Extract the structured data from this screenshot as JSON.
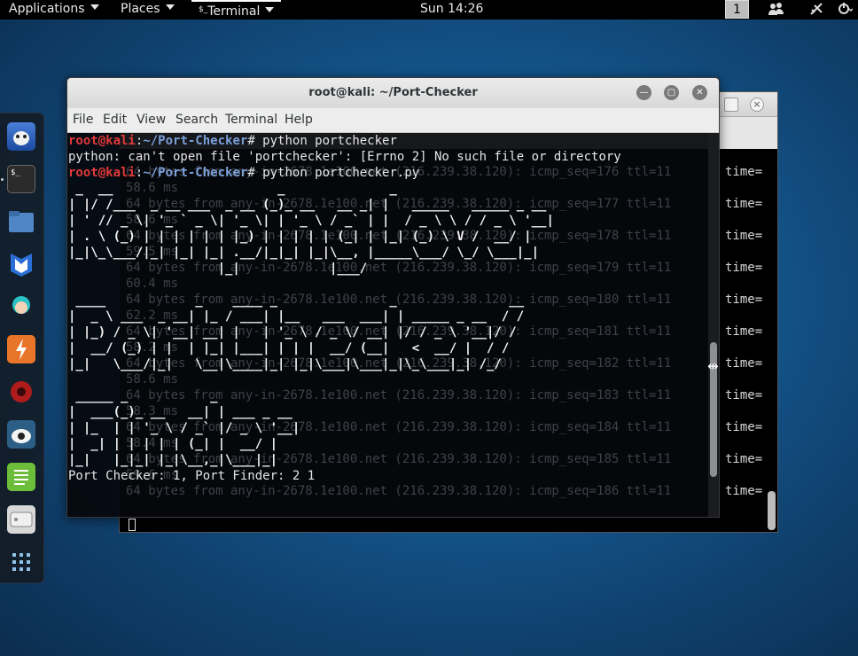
{
  "topbar": {
    "applications": "Applications",
    "places": "Places",
    "terminal": "Terminal",
    "clock": "Sun 14:26",
    "workspace": "1"
  },
  "dock": {
    "items": [
      "bug-app-icon",
      "terminal-app-icon",
      "files-app-icon",
      "metasploit-app-icon",
      "armitage-app-icon",
      "burp-app-icon",
      "faraday-app-icon",
      "maltego-app-icon",
      "notes-app-icon",
      "disk-app-icon",
      "show-apps-icon"
    ]
  },
  "front_terminal": {
    "title": "root@kali: ~/Port-Checker",
    "menu": [
      "File",
      "Edit",
      "View",
      "Search",
      "Terminal",
      "Help"
    ],
    "lines": [
      {
        "user": "root@kali",
        "sep": ":",
        "path": "~/Port-Checker",
        "cmd": "# python portchecker"
      },
      {
        "text": "python: can't open file 'portchecker': [Errno 2] No such file or directory"
      },
      {
        "user": "root@kali",
        "sep": ":",
        "path": "~/Port-Checker",
        "cmd": "# python portchecker.py"
      }
    ],
    "banner": [
      " _  __                      _              _                     ",
      "| |/ /___  _ __ ___  _ __ (_)_ __   __ _| |   _____   _____ _ __",
      "| ' // _ \\| '_ ` _ \\| '_ \\| | '_ \\ / _` | |  / _ \\ \\ / / _ \\ '__|",
      "| . \\ (_) | | | | | | |_) | | | | | (_| | |_| (_) \\ V /  __/ |",
      "|_|\\_\\___/|_| |_| |_| .__/|_|_| |_|\\__, |_____\\___/ \\_/ \\___|_|",
      "                    |_|            |___/",
      "",
      " ____            _    ____ _               _               __",
      "|  _ \\ ___  _ __| |_ / ___| |__   ___  ___| | _____ _ __  / /",
      "| |_) / _ \\| '__| __| |   | '_ \\ / _ \\/ __| |/ / _ \\ '__|/ /",
      "|  __/ (_) | |  | |_| |___| | | |  __/ (__|   <  __/ |  / /",
      "|_|   \\___/|_|   \\__|\\____|_| |_|\\___|\\___|_|\\_\\___|_| /_/",
      "",
      " _____ _           _",
      "|  ___(_)_ __   __| | ___ _ __",
      "| |_  | | '_ \\ / _` |/ _ \\ '__|",
      "|  _| | | | | | (_| |  __/ |",
      "|_|   |_|_| |_|\\__,_|\\___|_|"
    ],
    "footer": "Port Checker: 1, Port Finder: 2 1"
  },
  "back_terminal": {
    "time_label": "time=",
    "ghost_lines": [
      "58.6 ms",
      "64 bytes from any-in-2678.1e100.net (216.239.38.120): icmp_seq=177 ttl=11",
      "58.6 ms",
      "64 bytes from any-in-2678.1e100.net (216.239.38.120): icmp_seq=178 ttl=11",
      "59.5 ms",
      "64 bytes from any-in-2678.1e100.net (216.239.38.120): icmp_seq=179 ttl=11",
      "60.4 ms",
      "64 bytes from any-in-2678.1e100.net (216.239.38.120): icmp_seq=180 ttl=11",
      "62.2 ms",
      "64 bytes from any-in-2678.1e100.net (216.239.38.120): icmp_seq=181 ttl=11",
      "58.2 ms",
      "64 bytes from any-in-2678.1e100.net (216.239.38.120): icmp_seq=182 ttl=11",
      "58.6 ms",
      "64 bytes from any-in-2678.1e100.net (216.239.38.120): icmp_seq=183 ttl=11",
      "58.3 ms",
      "64 bytes from any-in-2678.1e100.net (216.239.38.120): icmp_seq=184 ttl=11",
      "58.4 ms",
      "64 bytes from any-in-2678.1e100.net (216.239.38.120): icmp_seq=185 ttl=11",
      "59.6 ms",
      "64 bytes from any-in-2678.1e100.net (216.239.38.120): icmp_seq=186 ttl=11"
    ],
    "ghost_top": "64 bytes from any-in-2678.1e100.net (216.239.38.120): icmp_seq=176 ttl=11"
  },
  "colors": {
    "prompt_user": "#e23a3a",
    "prompt_path": "#7b9fd8",
    "desktop": "#155a92"
  }
}
